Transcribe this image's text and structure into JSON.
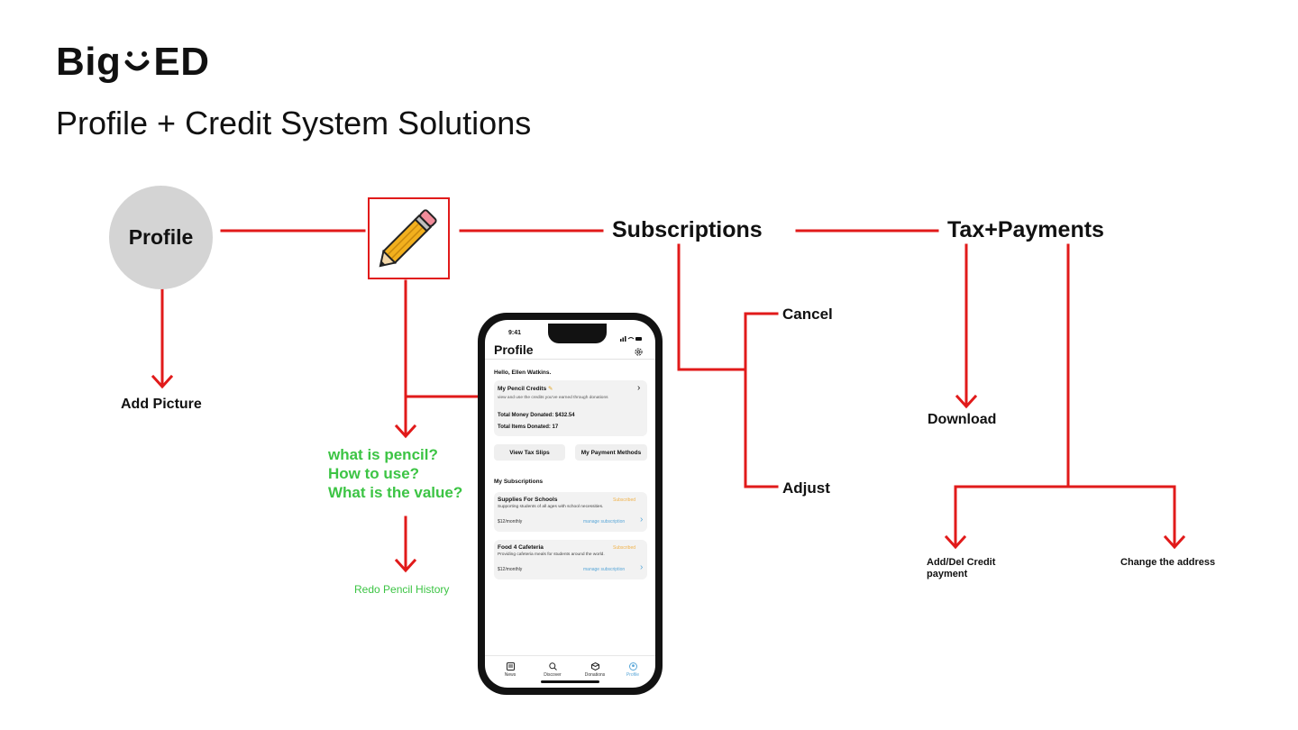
{
  "header": {
    "logo_left": "Big",
    "logo_right": "ED",
    "title": "Profile + Credit System Solutions"
  },
  "diagram": {
    "profile": "Profile",
    "add_picture": "Add Picture",
    "subscriptions": "Subscriptions",
    "cancel": "Cancel",
    "adjust": "Adjust",
    "tax_payments": "Tax+Payments",
    "download": "Download",
    "add_del_credit_line1": "Add/Del Credit",
    "add_del_credit_line2": "payment",
    "change_address": "Change the address",
    "questions": [
      "what is pencil?",
      "How to use?",
      "What is the value?"
    ],
    "redo_history": "Redo Pencil History"
  },
  "colors": {
    "connector": "#e11a1a",
    "question_green": "#3cc444",
    "profile_circle": "#d4d4d4",
    "subscribed": "#f0b24a",
    "manage_link": "#5aa7d8"
  },
  "phone": {
    "time": "9:41",
    "title": "Profile",
    "greeting": "Hello, Ellen Watkins.",
    "credits_title": "My Pencil Credits",
    "credits_desc": "view and use the credits you've earned through donations",
    "money_donated": "Total Money Donated: $432.54",
    "items_donated": "Total Items Donated: 17",
    "btn_tax": "View Tax Slips",
    "btn_payment": "My Payment Methods",
    "subs_heading": "My Subscriptions",
    "subs": [
      {
        "name": "Supplies For Schools",
        "status": "Subscribed",
        "desc": "Supporting students of all ages with school necessities.",
        "price": "$12/monthly",
        "link": "manage subscription"
      },
      {
        "name": "Food 4 Cafeteria",
        "status": "Subscribed",
        "desc": "Providing cafeteria meals for students around the world.",
        "price": "$12/monthly",
        "link": "manage subscription"
      }
    ],
    "nav": [
      "News",
      "Discover",
      "Donations",
      "Profile"
    ]
  }
}
